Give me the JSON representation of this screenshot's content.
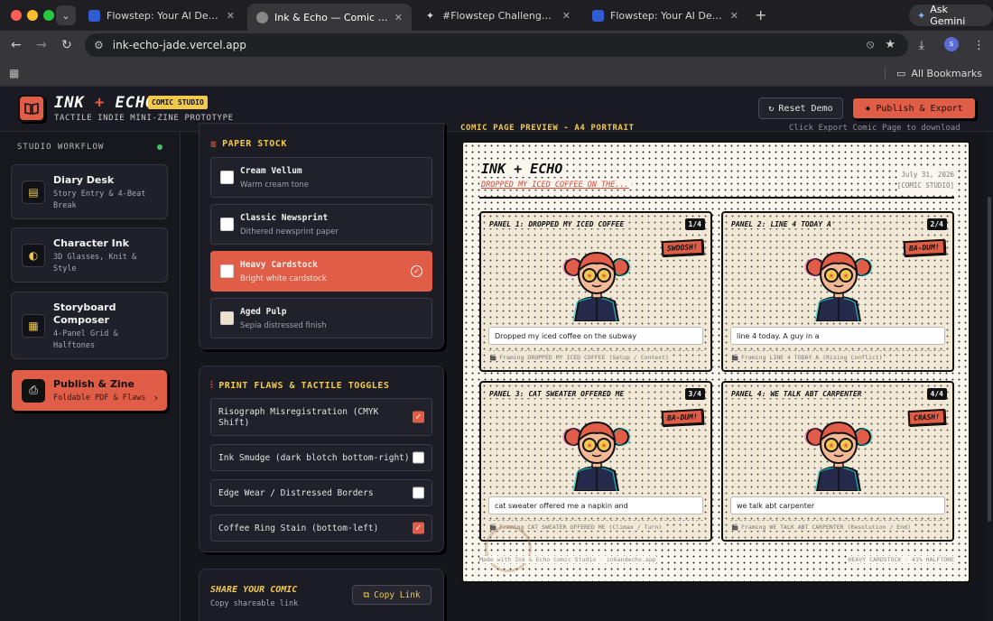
{
  "browser": {
    "tabs": [
      {
        "label": "Flowstep: Your AI Design Ass",
        "active": false
      },
      {
        "label": "Ink & Echo — Comic Studio Pr",
        "active": true
      },
      {
        "label": "#Flowstep Challenge on Cont",
        "active": false
      },
      {
        "label": "Flowstep: Your AI Design Ass",
        "active": false
      }
    ],
    "gemini_label": "Ask Gemini",
    "url": "ink-echo-jade.vercel.app",
    "profile_initial": "s",
    "all_bookmarks": "All Bookmarks"
  },
  "header": {
    "brand_left": "INK",
    "brand_amp": "+",
    "brand_right": "ECHO",
    "badge": "COMIC STUDIO",
    "tagline": "TACTILE INDIE MINI-ZINE PROTOTYPE",
    "reset_label": "Reset Demo",
    "publish_label": "Publish & Export"
  },
  "sidebar": {
    "title": "STUDIO WORKFLOW",
    "items": [
      {
        "name": "Diary Desk",
        "sub1": "Story Entry & 4-Beat",
        "sub2": "Break"
      },
      {
        "name": "Character Ink",
        "sub1": "3D Glasses, Knit &",
        "sub2": "Style"
      },
      {
        "name": "Storyboard",
        "name2": "Composer",
        "sub1": "4-Panel Grid &",
        "sub2": "Halftones"
      },
      {
        "name": "Publish & Zine",
        "sub1": "Foldable PDF & Flaws"
      }
    ]
  },
  "paper": {
    "title": "PAPER STOCK",
    "stocks": [
      {
        "name": "Cream Vellum",
        "desc": "Warm cream tone"
      },
      {
        "name": "Classic Newsprint",
        "desc": "Dithered newsprint paper"
      },
      {
        "name": "Heavy Cardstock",
        "desc": "Bright white cardstock"
      },
      {
        "name": "Aged Pulp",
        "desc": "Sepia distressed finish"
      }
    ],
    "selected_index": 2
  },
  "flaws": {
    "title": "PRINT FLAWS & TACTILE TOGGLES",
    "toggles": [
      {
        "line1": "Risograph Misregistration (CMYK",
        "line2": "Shift)",
        "on": true
      },
      {
        "line1": "Ink Smudge (dark blotch bottom-right)",
        "on": false
      },
      {
        "line1": "Edge Wear / Distressed Borders",
        "on": false
      },
      {
        "line1": "Coffee Ring Stain (bottom-left)",
        "on": true
      }
    ]
  },
  "share": {
    "title": "SHARE YOUR COMIC",
    "sub": "Copy shareable link",
    "button": "Copy Link"
  },
  "preview": {
    "label": "COMIC PAGE PREVIEW - A4 PORTRAIT",
    "hint": "Click Export Comic Page to download",
    "page_title": "INK + ECHO",
    "page_sub": "DROPPED MY ICED COFFEE ON THE...",
    "date": "July 31, 2026",
    "studio_tag": "[COMIC STUDIO]",
    "footer_left": "Made with Ink & Echo Comic Studio · inkandecho.app",
    "footer_right": "HEAVY CARDSTOCK · 41% HALFTONE",
    "panels": [
      {
        "title": "PANEL 1: DROPPED MY ICED COFFEE",
        "num": "1/4",
        "sfx": "SWOOSH!",
        "caption": "Dropped my iced coffee on the subway",
        "meta": "Framing DROPPED MY ICED COFFEE (Setup / Context)"
      },
      {
        "title": "PANEL 2: LINE 4 TODAY A",
        "num": "2/4",
        "sfx": "BA-DUM!",
        "caption": "line 4 today. A guy in a",
        "meta": "Framing LINE 4 TODAY A (Rising Conflict)"
      },
      {
        "title": "PANEL 3: CAT SWEATER OFFERED ME",
        "num": "3/4",
        "sfx": "BA-DUM!",
        "caption": "cat sweater offered me a napkin and",
        "meta": "Framing CAT SWEATER OFFERED ME (Climax / Turn)"
      },
      {
        "title": "PANEL 4: WE TALK ABT CARPENTER",
        "num": "4/4",
        "sfx": "CRASH!",
        "caption": "we talk abt carpenter",
        "meta": "Framing WE TALK ABT CARPENTER (Resolution / End)"
      }
    ]
  },
  "colors": {
    "accent": "#e05d47",
    "highlight": "#f2c94c",
    "background": "#15161c"
  }
}
